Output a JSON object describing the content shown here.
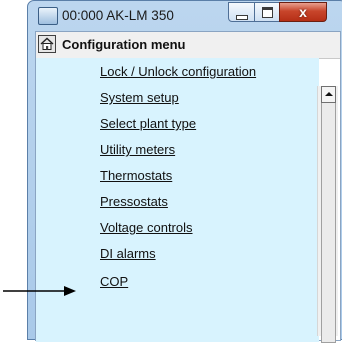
{
  "window": {
    "title": "00:000 AK-LM 350",
    "close_glyph": "x"
  },
  "menu": {
    "title": "Configuration menu",
    "items": [
      {
        "label": "Lock / Unlock configuration"
      },
      {
        "label": "System setup"
      },
      {
        "label": "Select plant type"
      },
      {
        "label": "Utility meters"
      },
      {
        "label": "Thermostats"
      },
      {
        "label": "Pressostats"
      },
      {
        "label": "Voltage controls"
      },
      {
        "label": "DI alarms"
      },
      {
        "label": "COP"
      }
    ]
  },
  "colors": {
    "list_background": "#d8f3fe",
    "window_frame": "#a9c9e9",
    "close_button": "#c8452b"
  },
  "icons": [
    "app-icon",
    "minimize-icon",
    "maximize-icon",
    "close-icon",
    "home-icon",
    "scroll-up-icon",
    "arrow-icon"
  ]
}
